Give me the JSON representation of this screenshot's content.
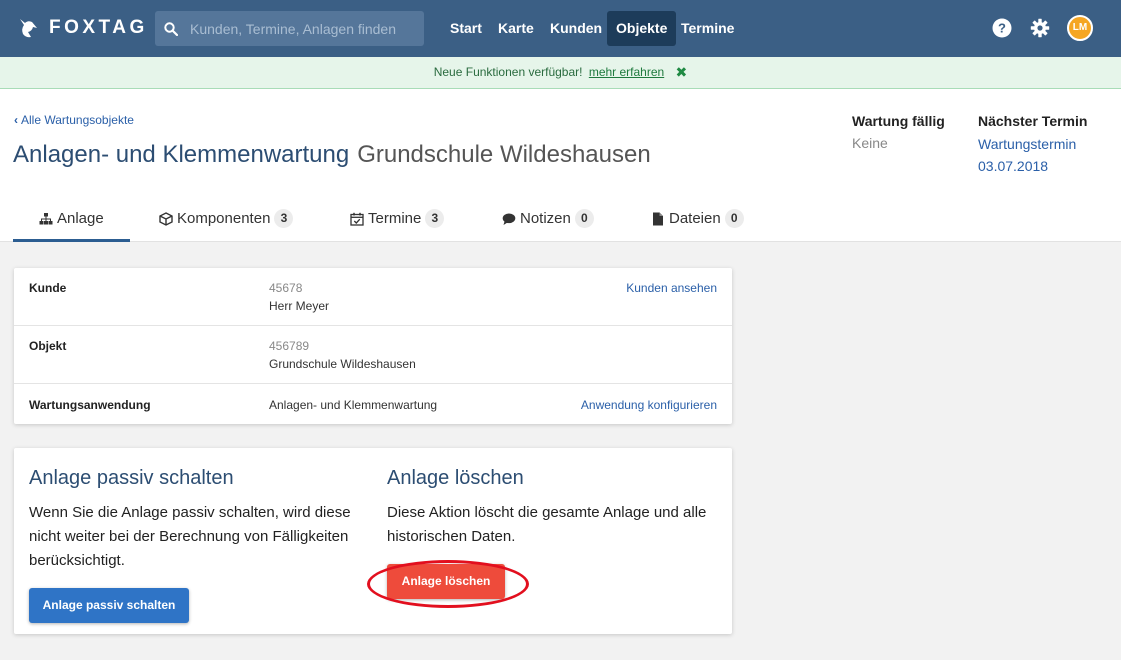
{
  "app": {
    "brand": "FOXTAG",
    "search_placeholder": "Kunden, Termine, Anlagen finden",
    "nav": [
      {
        "label": "Start",
        "active": false
      },
      {
        "label": "Karte",
        "active": false
      },
      {
        "label": "Kunden",
        "active": false
      },
      {
        "label": "Objekte",
        "active": true
      },
      {
        "label": "Termine",
        "active": false
      }
    ],
    "avatar_initials": "LM"
  },
  "announcement": {
    "text": "Neue Funktionen verfügbar!",
    "link": "mehr erfahren",
    "close_glyph": "✖"
  },
  "header": {
    "back_link": "Alle Wartungsobjekte",
    "title_main": "Anlagen- und Klemmenwartung",
    "title_sub": "Grundschule Wildeshausen",
    "due_label": "Wartung fällig",
    "due_value": "Keine",
    "next_label": "Nächster Termin",
    "next_value_line1": "Wartungstermin",
    "next_value_line2": "03.07.2018"
  },
  "tabs": [
    {
      "label": "Anlage",
      "icon": "sitemap-icon",
      "count": null,
      "active": true
    },
    {
      "label": "Komponenten",
      "icon": "cube-icon",
      "count": "3",
      "active": false
    },
    {
      "label": "Termine",
      "icon": "calendar-check-icon",
      "count": "3",
      "active": false
    },
    {
      "label": "Notizen",
      "icon": "comment-icon",
      "count": "0",
      "active": false
    },
    {
      "label": "Dateien",
      "icon": "file-icon",
      "count": "0",
      "active": false
    }
  ],
  "info": {
    "customer": {
      "label": "Kunde",
      "number": "45678",
      "name": "Herr Meyer",
      "action": "Kunden ansehen"
    },
    "object": {
      "label": "Objekt",
      "number": "456789",
      "name": "Grundschule Wildeshausen"
    },
    "application": {
      "label": "Wartungsanwendung",
      "value": "Anlagen- und Klemmenwartung",
      "action": "Anwendung konfigurieren"
    }
  },
  "actions": {
    "passive": {
      "title": "Anlage passiv schalten",
      "text": "Wenn Sie die Anlage passiv schalten, wird diese nicht weiter bei der Berechnung von Fälligkeiten berücksichtigt.",
      "button": "Anlage passiv schalten"
    },
    "delete": {
      "title": "Anlage löschen",
      "text": "Diese Aktion löscht die gesamte Anlage und alle historischen Daten.",
      "button": "Anlage löschen"
    }
  },
  "colors": {
    "navbar": "#3b5f85",
    "accent": "#2c4d72",
    "link": "#2a5fa8",
    "danger": "#ee4b3b",
    "primary": "#2f74c6",
    "highlight": "#e20f1e"
  }
}
